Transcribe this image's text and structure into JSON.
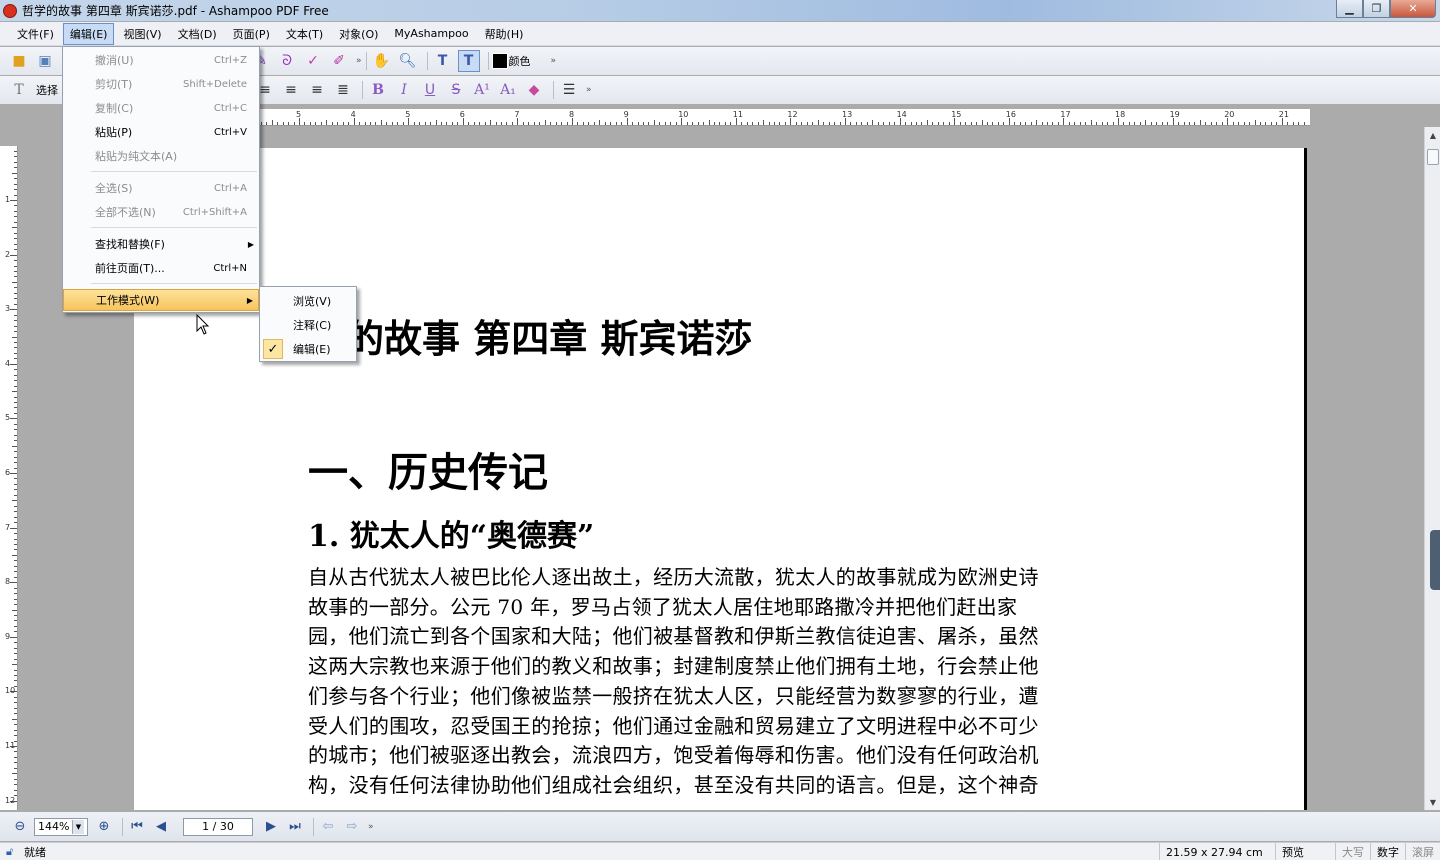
{
  "window": {
    "title": "哲学的故事 第四章 斯宾诺莎.pdf - Ashampoo PDF Free",
    "minimize_icon": "minimize-icon",
    "maximize_icon": "maximize-icon",
    "close_icon": "close-icon"
  },
  "menubar": {
    "items": [
      "文件(F)",
      "编辑(E)",
      "视图(V)",
      "文档(D)",
      "页面(P)",
      "文本(T)",
      "对象(O)",
      "MyAshampoo",
      "帮助(H)"
    ],
    "active_index": 1
  },
  "toolbar": {
    "color_label": "颜色",
    "select_label": "选择",
    "more": "»"
  },
  "edit_menu": {
    "items": [
      {
        "label": "撤消(U)",
        "shortcut": "Ctrl+Z",
        "enabled": false
      },
      {
        "label": "剪切(T)",
        "shortcut": "Shift+Delete",
        "enabled": false
      },
      {
        "label": "复制(C)",
        "shortcut": "Ctrl+C",
        "enabled": false
      },
      {
        "label": "粘贴(P)",
        "shortcut": "Ctrl+V",
        "enabled": true
      },
      {
        "label": "粘贴为纯文本(A)",
        "shortcut": "",
        "enabled": false
      },
      {
        "label": "全选(S)",
        "shortcut": "Ctrl+A",
        "enabled": false
      },
      {
        "label": "全部不选(N)",
        "shortcut": "Ctrl+Shift+A",
        "enabled": false
      },
      {
        "label": "查找和替换(F)",
        "shortcut": "",
        "enabled": true,
        "submenu": true
      },
      {
        "label": "前往页面(T)...",
        "shortcut": "Ctrl+N",
        "enabled": true
      },
      {
        "label": "工作模式(W)",
        "shortcut": "",
        "enabled": true,
        "submenu": true,
        "highlighted": true
      }
    ]
  },
  "work_mode_submenu": {
    "items": [
      {
        "label": "浏览(V)",
        "checked": false
      },
      {
        "label": "注释(C)",
        "checked": false
      },
      {
        "label": "编辑(E)",
        "checked": true
      }
    ],
    "check_glyph": "✓"
  },
  "ruler": {
    "top_numbers": [
      "5",
      "4",
      "5",
      "6",
      "7",
      "8",
      "9",
      "10",
      "11",
      "12",
      "13",
      "14",
      "15",
      "16",
      "17",
      "18",
      "19",
      "20",
      "21"
    ],
    "left_numbers": [
      "1",
      "2",
      "3",
      "4",
      "5",
      "6",
      "7",
      "8",
      "9",
      "10",
      "11",
      "12"
    ]
  },
  "document": {
    "title": "学的故事  第四章  斯宾诺莎",
    "heading1": "一、历史传记",
    "heading2": "1.  犹太人的“奥德赛”",
    "body_lines": [
      "自从古代犹太人被巴比伦人逐出故土，经历大流散，犹太人的故事就成为欧洲史诗",
      "故事的一部分。公元 70 年，罗马占领了犹太人居住地耶路撒冷并把他们赶出家",
      "园，他们流亡到各个国家和大陆；他们被基督教和伊斯兰教信徒迫害、屠杀，虽然",
      "这两大宗教也来源于他们的教义和故事；封建制度禁止他们拥有土地，行会禁止他",
      "们参与各个行业；他们像被监禁一般挤在犹太人区，只能经营为数寥寥的行业，遭",
      "受人们的围攻，忍受国王的抢掠；他们通过金融和贸易建立了文明进程中必不可少",
      "的城市；他们被驱逐出教会，流浪四方，饱受着侮辱和伤害。他们没有任何政治机",
      "构，没有任何法律协助他们组成社会组织，甚至没有共同的语言。但是，这个神奇"
    ]
  },
  "navbar": {
    "zoom": "144%",
    "page": "1 / 30",
    "more": "»"
  },
  "statusbar": {
    "ready": "就绪",
    "page_size": "21.59 x 27.94 cm",
    "preview": "预览",
    "caps": "大写",
    "num": "数字",
    "scroll": "滚屏"
  },
  "colors": {
    "menu_highlight": "#f7c45c",
    "active_menu": "#c7dbf5",
    "workspace": "#ababab"
  }
}
